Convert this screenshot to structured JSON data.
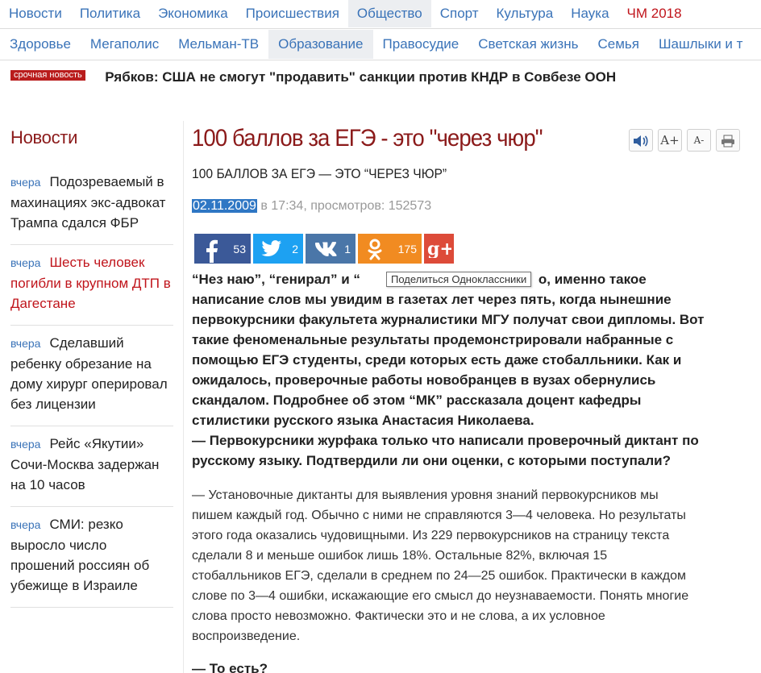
{
  "nav_primary": [
    {
      "label": "Новости"
    },
    {
      "label": "Политика"
    },
    {
      "label": "Экономика"
    },
    {
      "label": "Происшествия"
    },
    {
      "label": "Общество",
      "active": true
    },
    {
      "label": "Спорт"
    },
    {
      "label": "Культура"
    },
    {
      "label": "Наука"
    },
    {
      "label": "ЧМ 2018",
      "red": true
    }
  ],
  "nav_secondary": [
    {
      "label": "Здоровье"
    },
    {
      "label": "Мегаполис"
    },
    {
      "label": "Мельман-ТВ"
    },
    {
      "label": "Образование",
      "active": true
    },
    {
      "label": "Правосудие"
    },
    {
      "label": "Светская жизнь"
    },
    {
      "label": "Семья"
    },
    {
      "label": "Шашлыки и т"
    }
  ],
  "breaking": {
    "badge": "срочная новость",
    "headline": "Рябков: США не смогут \"продавить\" санкции против КНДР в Совбезе ООН"
  },
  "sidebar": {
    "title": "Новости",
    "items": [
      {
        "time": "вчера",
        "title": "Подозреваемый в махинациях экс-адвокат Трампа сдался ФБР",
        "highlight": false
      },
      {
        "time": "вчера",
        "title": "Шесть человек погибли в крупном ДТП в Дагестане",
        "highlight": true
      },
      {
        "time": "вчера",
        "title": "Сделавший ребенку обрезание на дому хирург оперировал без лицензии",
        "highlight": false
      },
      {
        "time": "вчера",
        "title": "Рейс «Якутии» Сочи-Москва задержан на 10 часов",
        "highlight": false
      },
      {
        "time": "вчера",
        "title": "СМИ: резко выросло число прошений россиян об убежище в Израиле",
        "highlight": false
      }
    ]
  },
  "article": {
    "title": "100 баллов за ЕГЭ - это \"через чюр\"",
    "subtitle": "100 БАЛЛОВ ЗА ЕГЭ — ЭТО “ЧЕРЕЗ ЧЮР”",
    "date": "02.11.2009",
    "meta_rest": " в 17:34, просмотров: 152573",
    "tools": {
      "audio": "audio-icon",
      "font_up": "A+",
      "font_down": "A-",
      "print": "print-icon"
    },
    "share": {
      "facebook": "53",
      "twitter": "2",
      "vk": "1",
      "odnoklassniki": "175",
      "googleplus": ""
    },
    "tooltip": "Поделиться Одноклассники",
    "lead_lines": [
      "“Нез наю”, “генирал” и “",
      "написание слов мы увидим в газетах лет через пять, когда нынешние",
      "первокурсники факультета журналистики МГУ получат свои дипломы. Вот",
      "такие феноменальные результаты продемонстрировали набранные с",
      "помощью ЕГЭ студенты, среди которых есть даже стобалльники. Как и",
      "ожидалось, проверочные работы новобранцев в вузах обернулись",
      "скандалом. Подробнее об этом “МК” рассказала доцент кафедры",
      "стилистики русского языка Анастасия Николаева.",
      "— Первокурсники журфака только что написали проверочный диктант по",
      "русскому языку. Подтвердили ли они оценки, с которыми поступали?"
    ],
    "lead_line1_tail": "о, именно такое",
    "body_lines": [
      "— Установочные диктанты для выявления уровня знаний первокурсников мы",
      "пишем каждый год. Обычно с ними не справляются 3—4 человека. Но результаты",
      "этого года оказались чудовищными. Из 229 первокурсников на страницу текста",
      "сделали 8 и меньше ошибок лишь 18%. Остальные 82%, включая 15",
      "стобалльников ЕГЭ, сделали в среднем по 24—25 ошибок. Практически в каждом",
      "слове по 3—4 ошибки, искажающие его смысл до неузнаваемости. Понять многие",
      "слова просто невозможно. Фактически это и не слова, а их условное",
      "воспроизведение."
    ],
    "question2": "— То есть?"
  }
}
